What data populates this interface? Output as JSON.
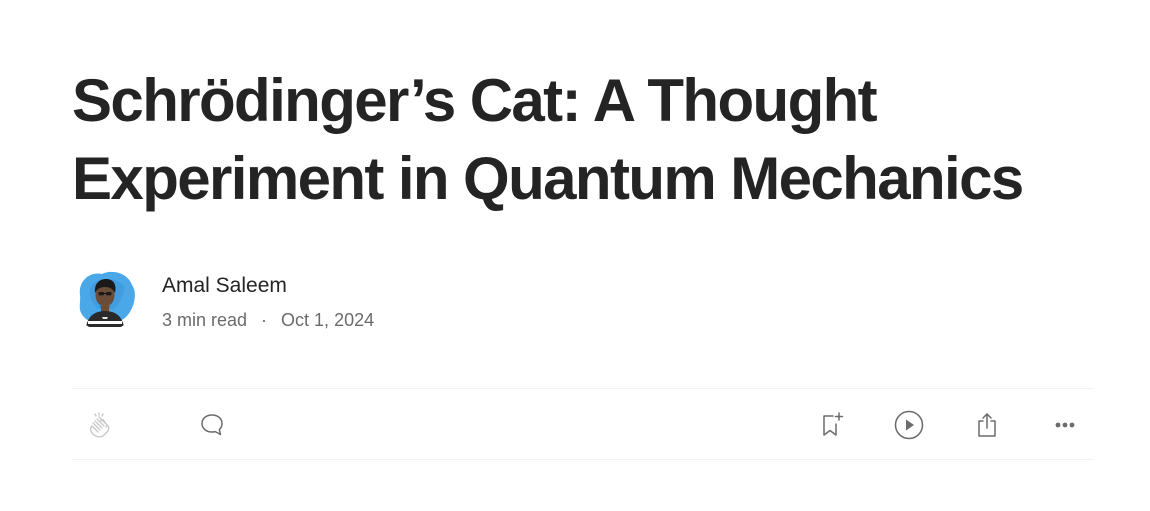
{
  "article": {
    "title": "Schrödinger’s Cat: A Thought Experiment in Quantum Mechanics",
    "author": {
      "name": "Amal Saleem"
    },
    "meta": {
      "read_time": "3 min read",
      "separator": "·",
      "date": "Oct 1, 2024"
    }
  },
  "actions": [
    {
      "id": "clap",
      "icon": "clap-icon"
    },
    {
      "id": "response",
      "icon": "comment-icon"
    },
    {
      "id": "save",
      "icon": "bookmark-add-icon"
    },
    {
      "id": "listen",
      "icon": "play-circle-icon"
    },
    {
      "id": "share",
      "icon": "share-icon"
    },
    {
      "id": "more",
      "icon": "more-horizontal-icon"
    }
  ],
  "colors": {
    "text_primary": "#242424",
    "text_secondary": "#6b6b6b",
    "divider": "#f2f2f2",
    "avatar_bg": "#4aa8e8"
  }
}
